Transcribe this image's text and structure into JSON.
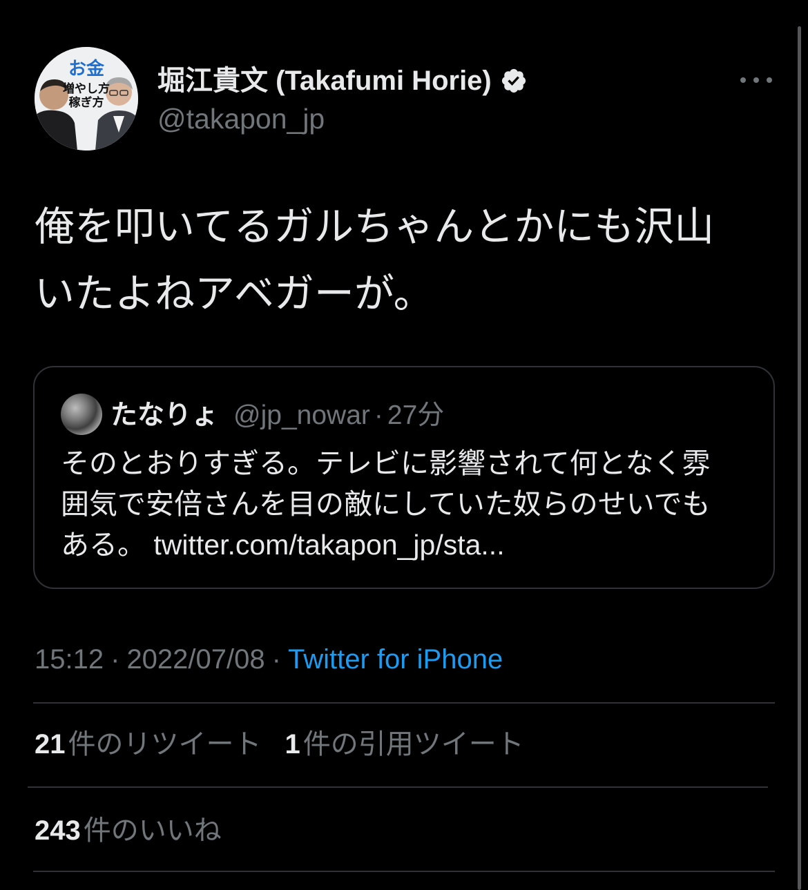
{
  "author": {
    "name": "堀江貴文 (Takafumi Horie)",
    "handle": "@takapon_jp",
    "verified_icon": "verified-badge-icon",
    "avatar_text": [
      "お金",
      "増やし方",
      "稼ぎ方"
    ]
  },
  "more_icon": "more-horizontal-icon",
  "tweet": {
    "text_lines": [
      "俺を叩いてるガルちゃんとかにも沢山",
      "いたよねアベガーが。"
    ]
  },
  "quote": {
    "name": "たなりょ",
    "handle": "@jp_nowar",
    "separator": "·",
    "time": "27分",
    "body_lines": [
      "そのとおりすぎる。テレビに影響されて何となく雰",
      "囲気で安倍さんを目の敵にしていた奴らのせいでも",
      "ある。 twitter.com/takapon_jp/sta..."
    ]
  },
  "meta": {
    "time": "15:12",
    "separator": "·",
    "date": "2022/07/08",
    "source": "Twitter for iPhone"
  },
  "stats": {
    "retweets_count": "21",
    "retweets_label": "件のリツイート",
    "quotes_count": "1",
    "quotes_label": "件の引用ツイート",
    "likes_count": "243",
    "likes_label": "件のいいね"
  },
  "colors": {
    "background": "#000000",
    "text_primary": "#e7e9ea",
    "text_secondary": "#71767b",
    "accent": "#1d9bf0",
    "border": "#2f3336"
  }
}
